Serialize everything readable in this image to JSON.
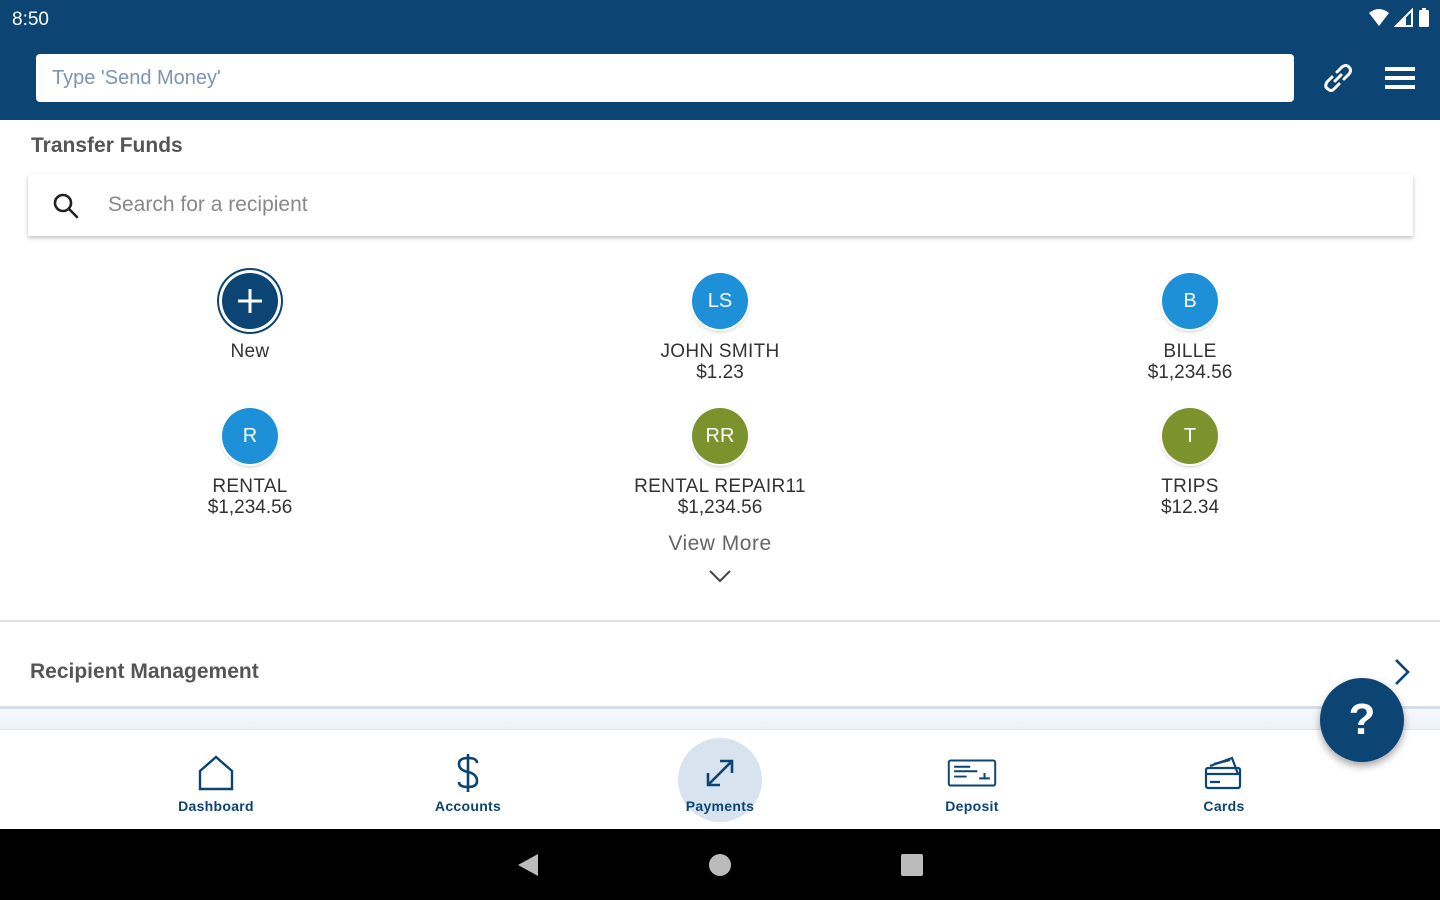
{
  "status_bar": {
    "time": "8:50"
  },
  "header": {
    "command_placeholder": "Type 'Send Money'"
  },
  "transfer": {
    "title": "Transfer Funds",
    "search_placeholder": "Search for a recipient",
    "new_label": "New",
    "recipients": [
      {
        "initials": "LS",
        "name": "JOHN SMITH",
        "amount": "$1.23",
        "color": "#1d90d8"
      },
      {
        "initials": "B",
        "name": "BILLE",
        "amount": "$1,234.56",
        "color": "#1d90d8"
      },
      {
        "initials": "R",
        "name": "RENTAL",
        "amount": "$1,234.56",
        "color": "#1d90d8"
      },
      {
        "initials": "RR",
        "name": "RENTAL REPAIR11",
        "amount": "$1,234.56",
        "color": "#7c922c"
      },
      {
        "initials": "T",
        "name": "TRIPS",
        "amount": "$12.34",
        "color": "#7c922c"
      }
    ],
    "view_more": "View More"
  },
  "recipient_management": {
    "label": "Recipient Management"
  },
  "help": {
    "label": "?"
  },
  "bottom_nav": [
    {
      "label": "Dashboard",
      "icon": "home-icon"
    },
    {
      "label": "Accounts",
      "icon": "dollar-icon"
    },
    {
      "label": "Payments",
      "icon": "transfer-arrows-icon",
      "active": true
    },
    {
      "label": "Deposit",
      "icon": "check-deposit-icon"
    },
    {
      "label": "Cards",
      "icon": "cards-icon"
    }
  ],
  "theme": {
    "primary": "#0c4474",
    "accent_blue": "#1d90d8",
    "accent_green": "#7c922c"
  }
}
